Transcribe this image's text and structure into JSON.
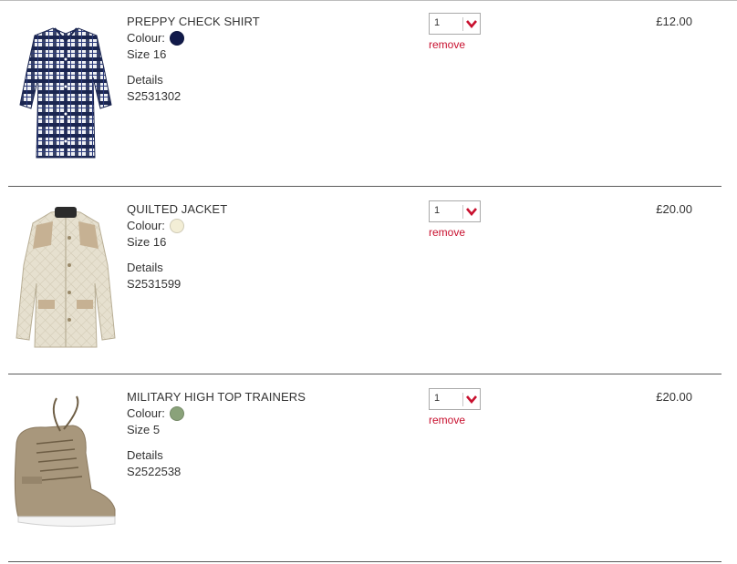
{
  "basket": {
    "items": [
      {
        "name": "PREPPY CHECK SHIRT",
        "colour_label": "Colour:",
        "colour_hex": "#111a4a",
        "size": "Size 16",
        "details_label": "Details",
        "sku": "S2531302",
        "quantity": "1",
        "remove_label": "remove",
        "price": "£12.00",
        "image_icon": "check-shirt"
      },
      {
        "name": "QUILTED JACKET",
        "colour_label": "Colour:",
        "colour_hex": "#f3eed6",
        "size": "Size 16",
        "details_label": "Details",
        "sku": "S2531599",
        "quantity": "1",
        "remove_label": "remove",
        "price": "£20.00",
        "image_icon": "quilted-jacket"
      },
      {
        "name": "MILITARY HIGH TOP TRAINERS",
        "colour_label": "Colour:",
        "colour_hex": "#8aa27a",
        "size": "Size 5",
        "details_label": "Details",
        "sku": "S2522538",
        "quantity": "1",
        "remove_label": "remove",
        "price": "£20.00",
        "image_icon": "high-top-trainer"
      }
    ]
  },
  "colors": {
    "remove_link": "#c8102e",
    "dropdown_chevron": "#c8102e",
    "divider": "#5a5a5a"
  }
}
